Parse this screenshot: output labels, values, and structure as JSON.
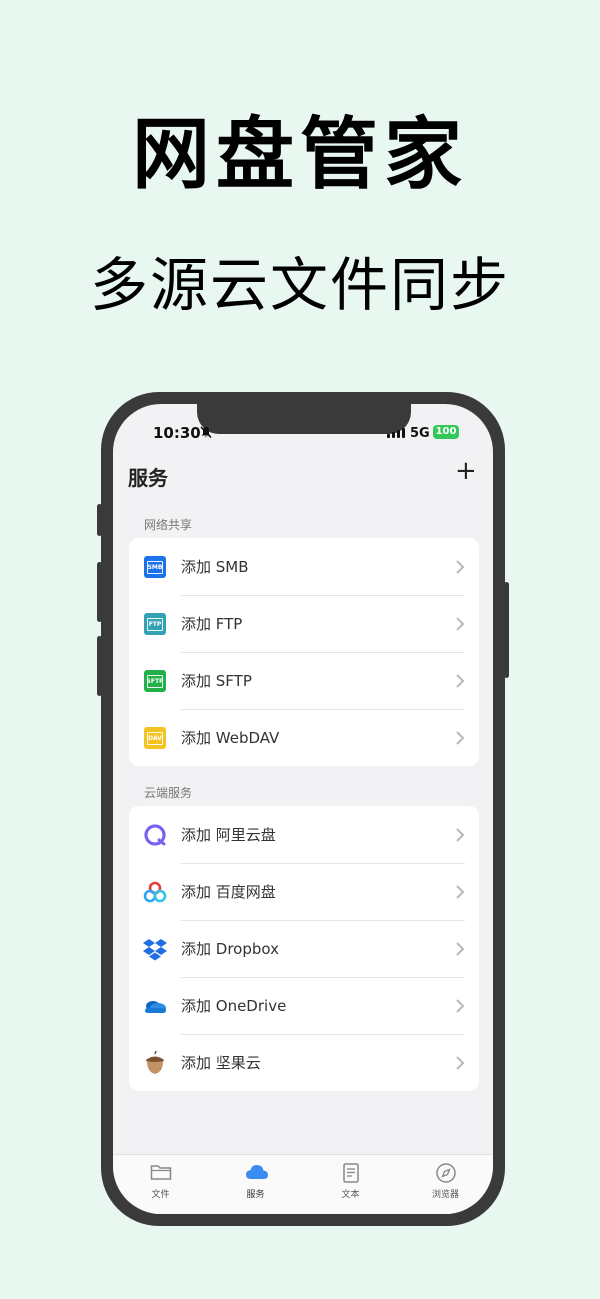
{
  "headline": "网盘管家",
  "subline": "多源云文件同步",
  "status": {
    "time": "10:30",
    "network": "5G",
    "battery": "100"
  },
  "nav": {
    "title": "服务",
    "add_symbol": "+"
  },
  "sections": {
    "network": {
      "label": "网络共享",
      "items": [
        {
          "label": "添加 SMB",
          "icon": "smb-icon",
          "badge": "SMB",
          "color": "#1a73e8"
        },
        {
          "label": "添加 FTP",
          "icon": "ftp-icon",
          "badge": "FTP",
          "color": "#34a1b5"
        },
        {
          "label": "添加 SFTP",
          "icon": "sftp-icon",
          "badge": "SFTP",
          "color": "#22b04b"
        },
        {
          "label": "添加 WebDAV",
          "icon": "webdav-icon",
          "badge": "DAV",
          "color": "#f4c221"
        }
      ]
    },
    "cloud": {
      "label": "云端服务",
      "items": [
        {
          "label": "添加 阿里云盘",
          "icon": "aliyun-drive-icon"
        },
        {
          "label": "添加 百度网盘",
          "icon": "baidu-netdisk-icon"
        },
        {
          "label": "添加 Dropbox",
          "icon": "dropbox-icon"
        },
        {
          "label": "添加 OneDrive",
          "icon": "onedrive-icon"
        },
        {
          "label": "添加 坚果云",
          "icon": "jianguoyun-icon"
        }
      ]
    }
  },
  "tabs": [
    {
      "label": "文件",
      "icon": "folder-icon"
    },
    {
      "label": "服务",
      "icon": "cloud-icon",
      "active": true
    },
    {
      "label": "文本",
      "icon": "document-icon"
    },
    {
      "label": "浏览器",
      "icon": "compass-icon"
    }
  ],
  "colors": {
    "background": "#e8f8f0",
    "accent": "#3b8cf0",
    "battery": "#34c759"
  }
}
